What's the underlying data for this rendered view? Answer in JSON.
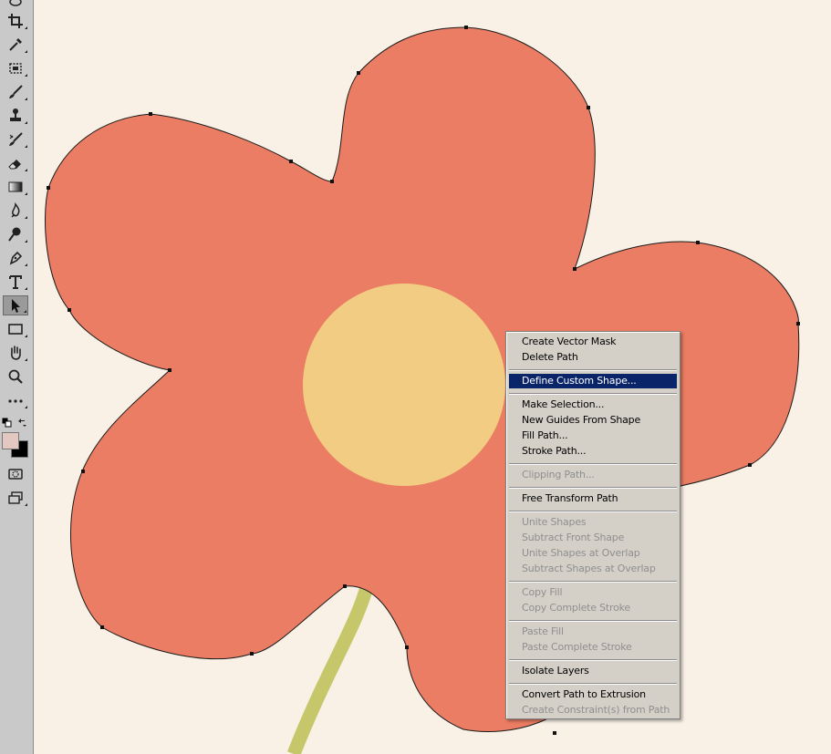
{
  "colors": {
    "canvas_bg": "#f9f1e6",
    "petal": "#ea7d63",
    "center": "#f1cc82",
    "stem": "#c6c76a",
    "menu_bg": "#d4d0c8",
    "highlight": "#0a246a"
  },
  "toolbar": {
    "tools": [
      {
        "name": "lasso-tool-icon"
      },
      {
        "name": "crop-tool-icon"
      },
      {
        "name": "eyedropper-tool-icon"
      },
      {
        "name": "healing-brush-tool-icon"
      },
      {
        "name": "brush-tool-icon"
      },
      {
        "name": "clone-stamp-tool-icon"
      },
      {
        "name": "history-brush-tool-icon"
      },
      {
        "name": "eraser-tool-icon"
      },
      {
        "name": "gradient-tool-icon"
      },
      {
        "name": "blur-tool-icon"
      },
      {
        "name": "dodge-tool-icon"
      },
      {
        "name": "pen-tool-icon"
      },
      {
        "name": "type-tool-icon"
      },
      {
        "name": "path-selection-tool-icon",
        "active": true
      },
      {
        "name": "rectangle-tool-icon"
      },
      {
        "name": "hand-tool-icon"
      },
      {
        "name": "zoom-tool-icon"
      },
      {
        "name": "more-tools-icon"
      }
    ],
    "foreground_color": "#e2c8c0",
    "background_color": "#000000"
  },
  "context_menu": {
    "items": [
      {
        "label": "Create Vector Mask",
        "enabled": true
      },
      {
        "label": "Delete Path",
        "enabled": true
      },
      {
        "separator": true
      },
      {
        "label": "Define Custom Shape...",
        "enabled": true,
        "highlighted": true
      },
      {
        "separator": true
      },
      {
        "label": "Make Selection...",
        "enabled": true
      },
      {
        "label": "New Guides From Shape",
        "enabled": true
      },
      {
        "label": "Fill Path...",
        "enabled": true
      },
      {
        "label": "Stroke Path...",
        "enabled": true
      },
      {
        "separator": true
      },
      {
        "label": "Clipping Path...",
        "enabled": false
      },
      {
        "separator": true
      },
      {
        "label": "Free Transform Path",
        "enabled": true
      },
      {
        "separator": true
      },
      {
        "label": "Unite Shapes",
        "enabled": false
      },
      {
        "label": "Subtract Front Shape",
        "enabled": false
      },
      {
        "label": "Unite Shapes at Overlap",
        "enabled": false
      },
      {
        "label": "Subtract Shapes at Overlap",
        "enabled": false
      },
      {
        "separator": true
      },
      {
        "label": "Copy Fill",
        "enabled": false
      },
      {
        "label": "Copy Complete Stroke",
        "enabled": false
      },
      {
        "separator": true
      },
      {
        "label": "Paste Fill",
        "enabled": false
      },
      {
        "label": "Paste Complete Stroke",
        "enabled": false
      },
      {
        "separator": true
      },
      {
        "label": "Isolate Layers",
        "enabled": true
      },
      {
        "separator": true
      },
      {
        "label": "Convert Path to Extrusion",
        "enabled": true
      },
      {
        "label": "Create Constraint(s) from Path",
        "enabled": false
      }
    ]
  }
}
